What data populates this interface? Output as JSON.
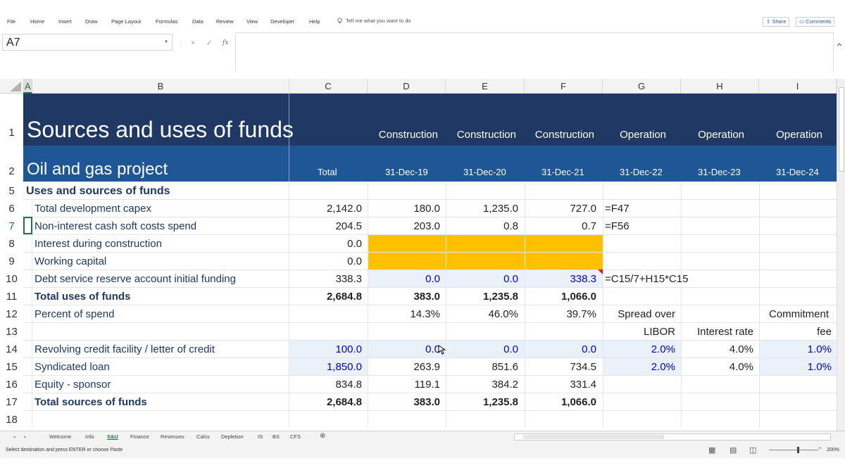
{
  "ribbon": {
    "tabs": [
      "File",
      "Home",
      "Insert",
      "Draw",
      "Page Layout",
      "Formulas",
      "Data",
      "Review",
      "View",
      "Developer",
      "Help"
    ],
    "tell_me": "Tell me what you want to do",
    "share": "Share",
    "comments": "Comments"
  },
  "formula_bar": {
    "name_box": "A7",
    "fx": "fx",
    "cancel": "×",
    "enter": "✓",
    "content": ""
  },
  "columns": [
    "A",
    "B",
    "C",
    "D",
    "E",
    "F",
    "G",
    "H",
    "I"
  ],
  "header": {
    "title": "Sources and uses of funds",
    "subtitle": "Oil and gas project",
    "phases": [
      "Construction",
      "Construction",
      "Construction",
      "Operation",
      "Operation",
      "Operation"
    ],
    "total_label": "Total",
    "dates": [
      "31-Dec-19",
      "31-Dec-20",
      "31-Dec-21",
      "31-Dec-22",
      "31-Dec-23",
      "31-Dec-24"
    ]
  },
  "rows": {
    "r5": {
      "num": "5",
      "label": "Uses and sources of funds"
    },
    "r6": {
      "num": "6",
      "label": "Total development capex",
      "c": "2,142.0",
      "d": "180.0",
      "e": "1,235.0",
      "f": "727.0",
      "g": "=F47"
    },
    "r7": {
      "num": "7",
      "label": "Non-interest cash soft costs spend",
      "c": "204.5",
      "d": "203.0",
      "e": "0.8",
      "f": "0.7",
      "g": "=F56"
    },
    "r8": {
      "num": "8",
      "label": "Interest during construction",
      "c": "0.0"
    },
    "r9": {
      "num": "9",
      "label": "Working capital",
      "c": "0.0"
    },
    "r10": {
      "num": "10",
      "label": "Debt service reserve account initial funding",
      "c": "338.3",
      "d": "0.0",
      "e": "0.0",
      "f": "338.3",
      "g": "=C15/7+H15*C15"
    },
    "r11": {
      "num": "11",
      "label": "Total uses of funds",
      "c": "2,684.8",
      "d": "383.0",
      "e": "1,235.8",
      "f": "1,066.0"
    },
    "r12": {
      "num": "12",
      "label": "Percent of spend",
      "d": "14.3%",
      "e": "46.0%",
      "f": "39.7%",
      "g": "Spread over",
      "i": "Commitment"
    },
    "r13": {
      "num": "13",
      "g": "LIBOR",
      "h": "Interest rate",
      "i": "fee"
    },
    "r14": {
      "num": "14",
      "label": "Revolving credit facility / letter of credit",
      "c": "100.0",
      "d": "0.0",
      "e": "0.0",
      "f": "0.0",
      "g": "2.0%",
      "h": "4.0%",
      "i": "1.0%"
    },
    "r15": {
      "num": "15",
      "label": "Syndicated loan",
      "c": "1,850.0",
      "d": "263.9",
      "e": "851.6",
      "f": "734.5",
      "g": "2.0%",
      "h": "4.0%",
      "i": "1.0%"
    },
    "r16": {
      "num": "16",
      "label": "Equity - sponsor",
      "c": "834.8",
      "d": "119.1",
      "e": "384.2",
      "f": "331.4"
    },
    "r17": {
      "num": "17",
      "label": "Total sources of funds",
      "c": "2,684.8",
      "d": "383.0",
      "e": "1,235.8",
      "f": "1,066.0"
    },
    "r18": {
      "num": "18"
    }
  },
  "row_numbers_header": [
    "1",
    "2"
  ],
  "sheet_tabs": [
    "Welcome",
    "Info",
    "S&U",
    "Finance",
    "Revenues",
    "Calcs",
    "Depletion",
    "IS",
    "BS",
    "CFS"
  ],
  "active_sheet": "S&U",
  "status": {
    "message": "Select destination and press ENTER or choose Paste",
    "zoom": "200%"
  },
  "colors": {
    "header_dark": "#1f3864",
    "header_mid": "#1f5796",
    "highlight": "#ffc000",
    "input_fill": "#eaf1fb",
    "excel_green": "#217346"
  }
}
